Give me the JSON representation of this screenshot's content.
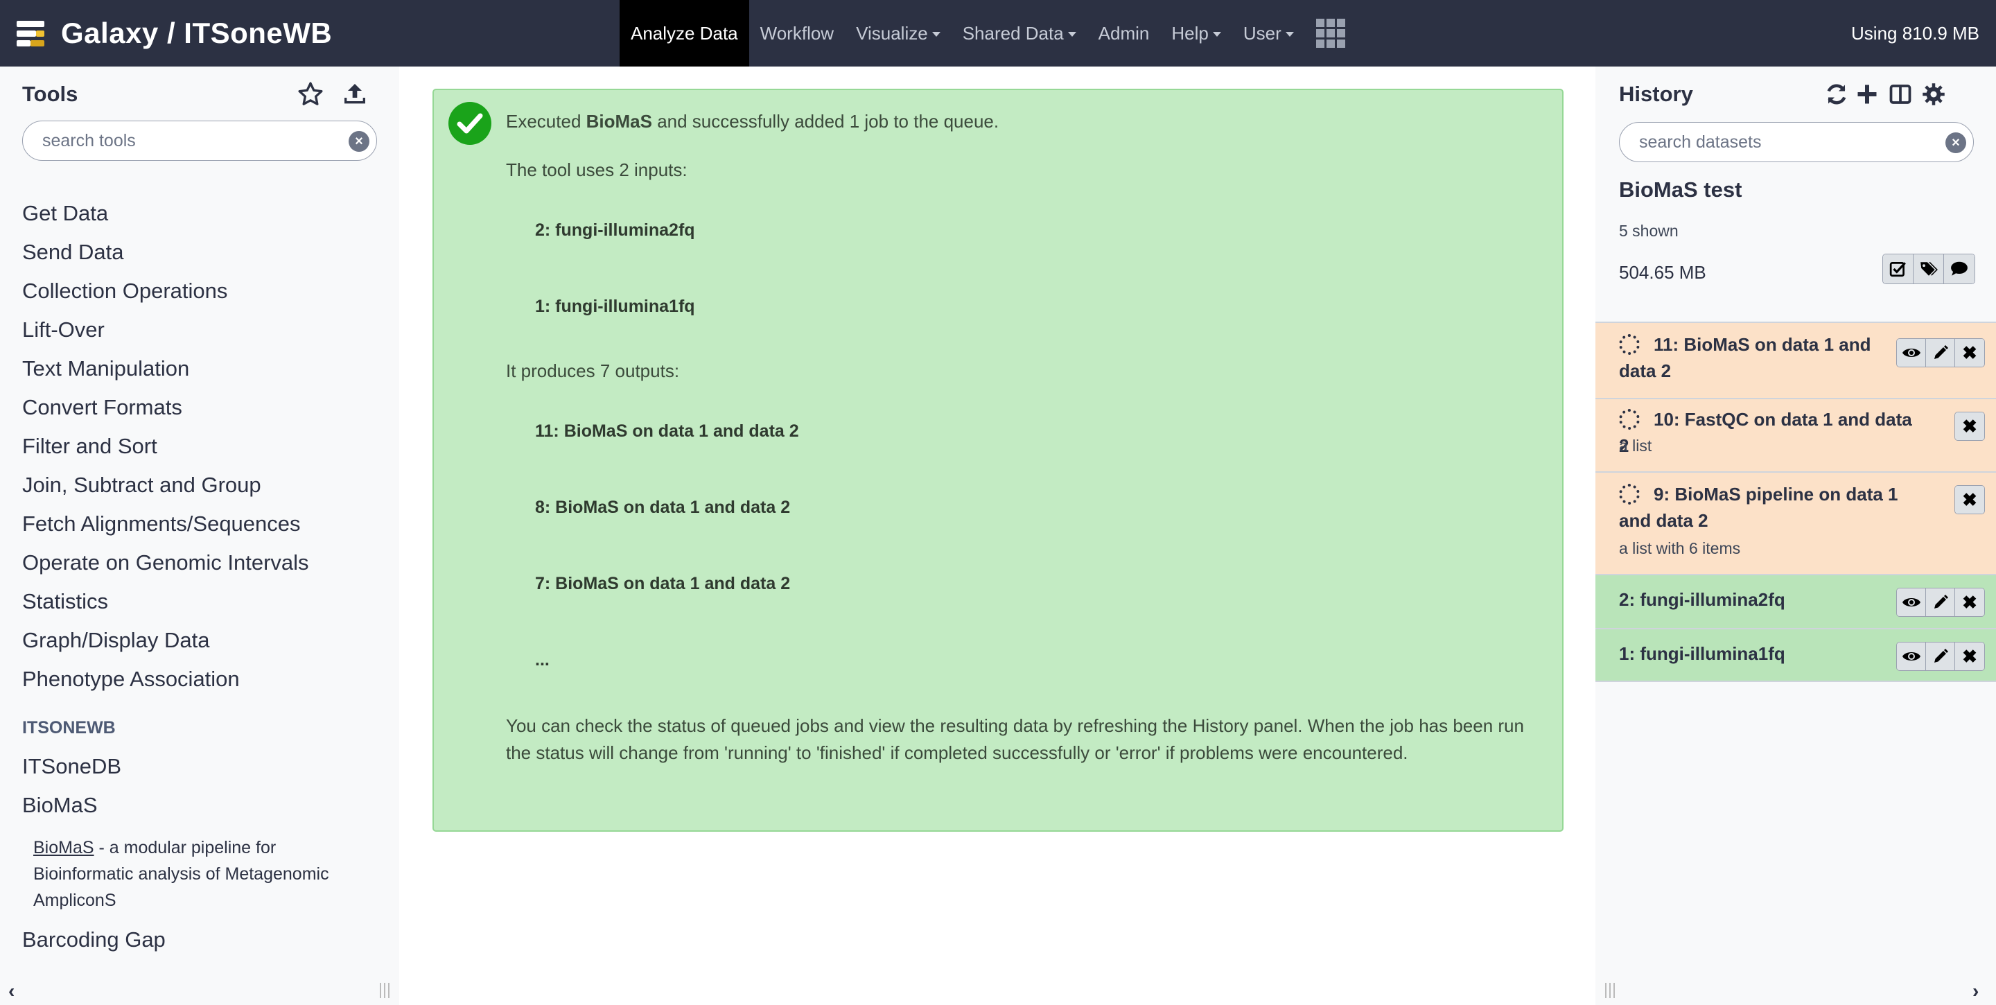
{
  "masthead": {
    "brand_title": "Galaxy / ITSoneWB",
    "nav": [
      {
        "label": "Analyze Data",
        "active": true,
        "dropdown": false
      },
      {
        "label": "Workflow",
        "active": false,
        "dropdown": false
      },
      {
        "label": "Visualize",
        "active": false,
        "dropdown": true
      },
      {
        "label": "Shared Data",
        "active": false,
        "dropdown": true
      },
      {
        "label": "Admin",
        "active": false,
        "dropdown": false
      },
      {
        "label": "Help",
        "active": false,
        "dropdown": true
      },
      {
        "label": "User",
        "active": false,
        "dropdown": true
      }
    ],
    "quota": "Using 810.9 MB"
  },
  "tools": {
    "title": "Tools",
    "search_placeholder": "search tools",
    "sections": [
      "Get Data",
      "Send Data",
      "Collection Operations",
      "Lift-Over",
      "Text Manipulation",
      "Convert Formats",
      "Filter and Sort",
      "Join, Subtract and Group",
      "Fetch Alignments/Sequences",
      "Operate on Genomic Intervals",
      "Statistics",
      "Graph/Display Data",
      "Phenotype Association"
    ],
    "label_itsonewb": "ITSONEWB",
    "itsonedb": "ITSoneDB",
    "biomas": "BioMaS",
    "biomas_link": "BioMaS",
    "biomas_desc": " - a modular pipeline for Bioinformatic analysis of Metagenomic AmpliconS",
    "barcoding_gap": "Barcoding Gap"
  },
  "center": {
    "executed_prefix": "Executed ",
    "tool_name": "BioMaS",
    "executed_suffix": " and successfully added 1 job to the queue.",
    "inputs_line": "The tool uses 2 inputs:",
    "inputs": [
      "2: fungi-illumina2fq",
      "1: fungi-illumina1fq"
    ],
    "outputs_line": "It produces 7 outputs:",
    "outputs": [
      "11: BioMaS on data 1 and data 2",
      "8: BioMaS on data 1 and data 2",
      "7: BioMaS on data 1 and data 2",
      "..."
    ],
    "note": "You can check the status of queued jobs and view the resulting data by refreshing the History panel. When the job has been run the status will change from 'running' to 'finished' if completed successfully or 'error' if problems were encountered."
  },
  "history": {
    "title": "History",
    "search_placeholder": "search datasets",
    "name": "BioMaS test",
    "shown": "5 shown",
    "size": "504.65 MB",
    "datasets": [
      {
        "title": "11: BioMaS on data 1 and data 2",
        "subtitle": "",
        "state": "queued"
      },
      {
        "title": "10: FastQC on data 1 and data 2",
        "subtitle": "a list",
        "state": "queued"
      },
      {
        "title": "9: BioMaS pipeline on data 1 and data 2",
        "subtitle": "a list with 6 items",
        "state": "queued"
      },
      {
        "title": "2: fungi-illumina2fq",
        "subtitle": "",
        "state": "ok"
      },
      {
        "title": "1: fungi-illumina1fq",
        "subtitle": "",
        "state": "ok"
      }
    ]
  },
  "colors": {
    "masthead_bg": "#2c3143",
    "alert_success_bg": "#c3ebc3",
    "dataset_queued_bg": "#fce1c8",
    "dataset_ok_bg": "#b9e4b9",
    "success_icon": "#1aa31a"
  },
  "icons": {
    "logo": "galaxy-logo",
    "apps": "grid-icon",
    "favorites": "star-icon",
    "upload": "upload-icon",
    "success": "check-circle-icon",
    "refresh": "refresh-icon",
    "new_history": "plus-icon",
    "columns": "columns-icon",
    "options": "gear-icon"
  }
}
